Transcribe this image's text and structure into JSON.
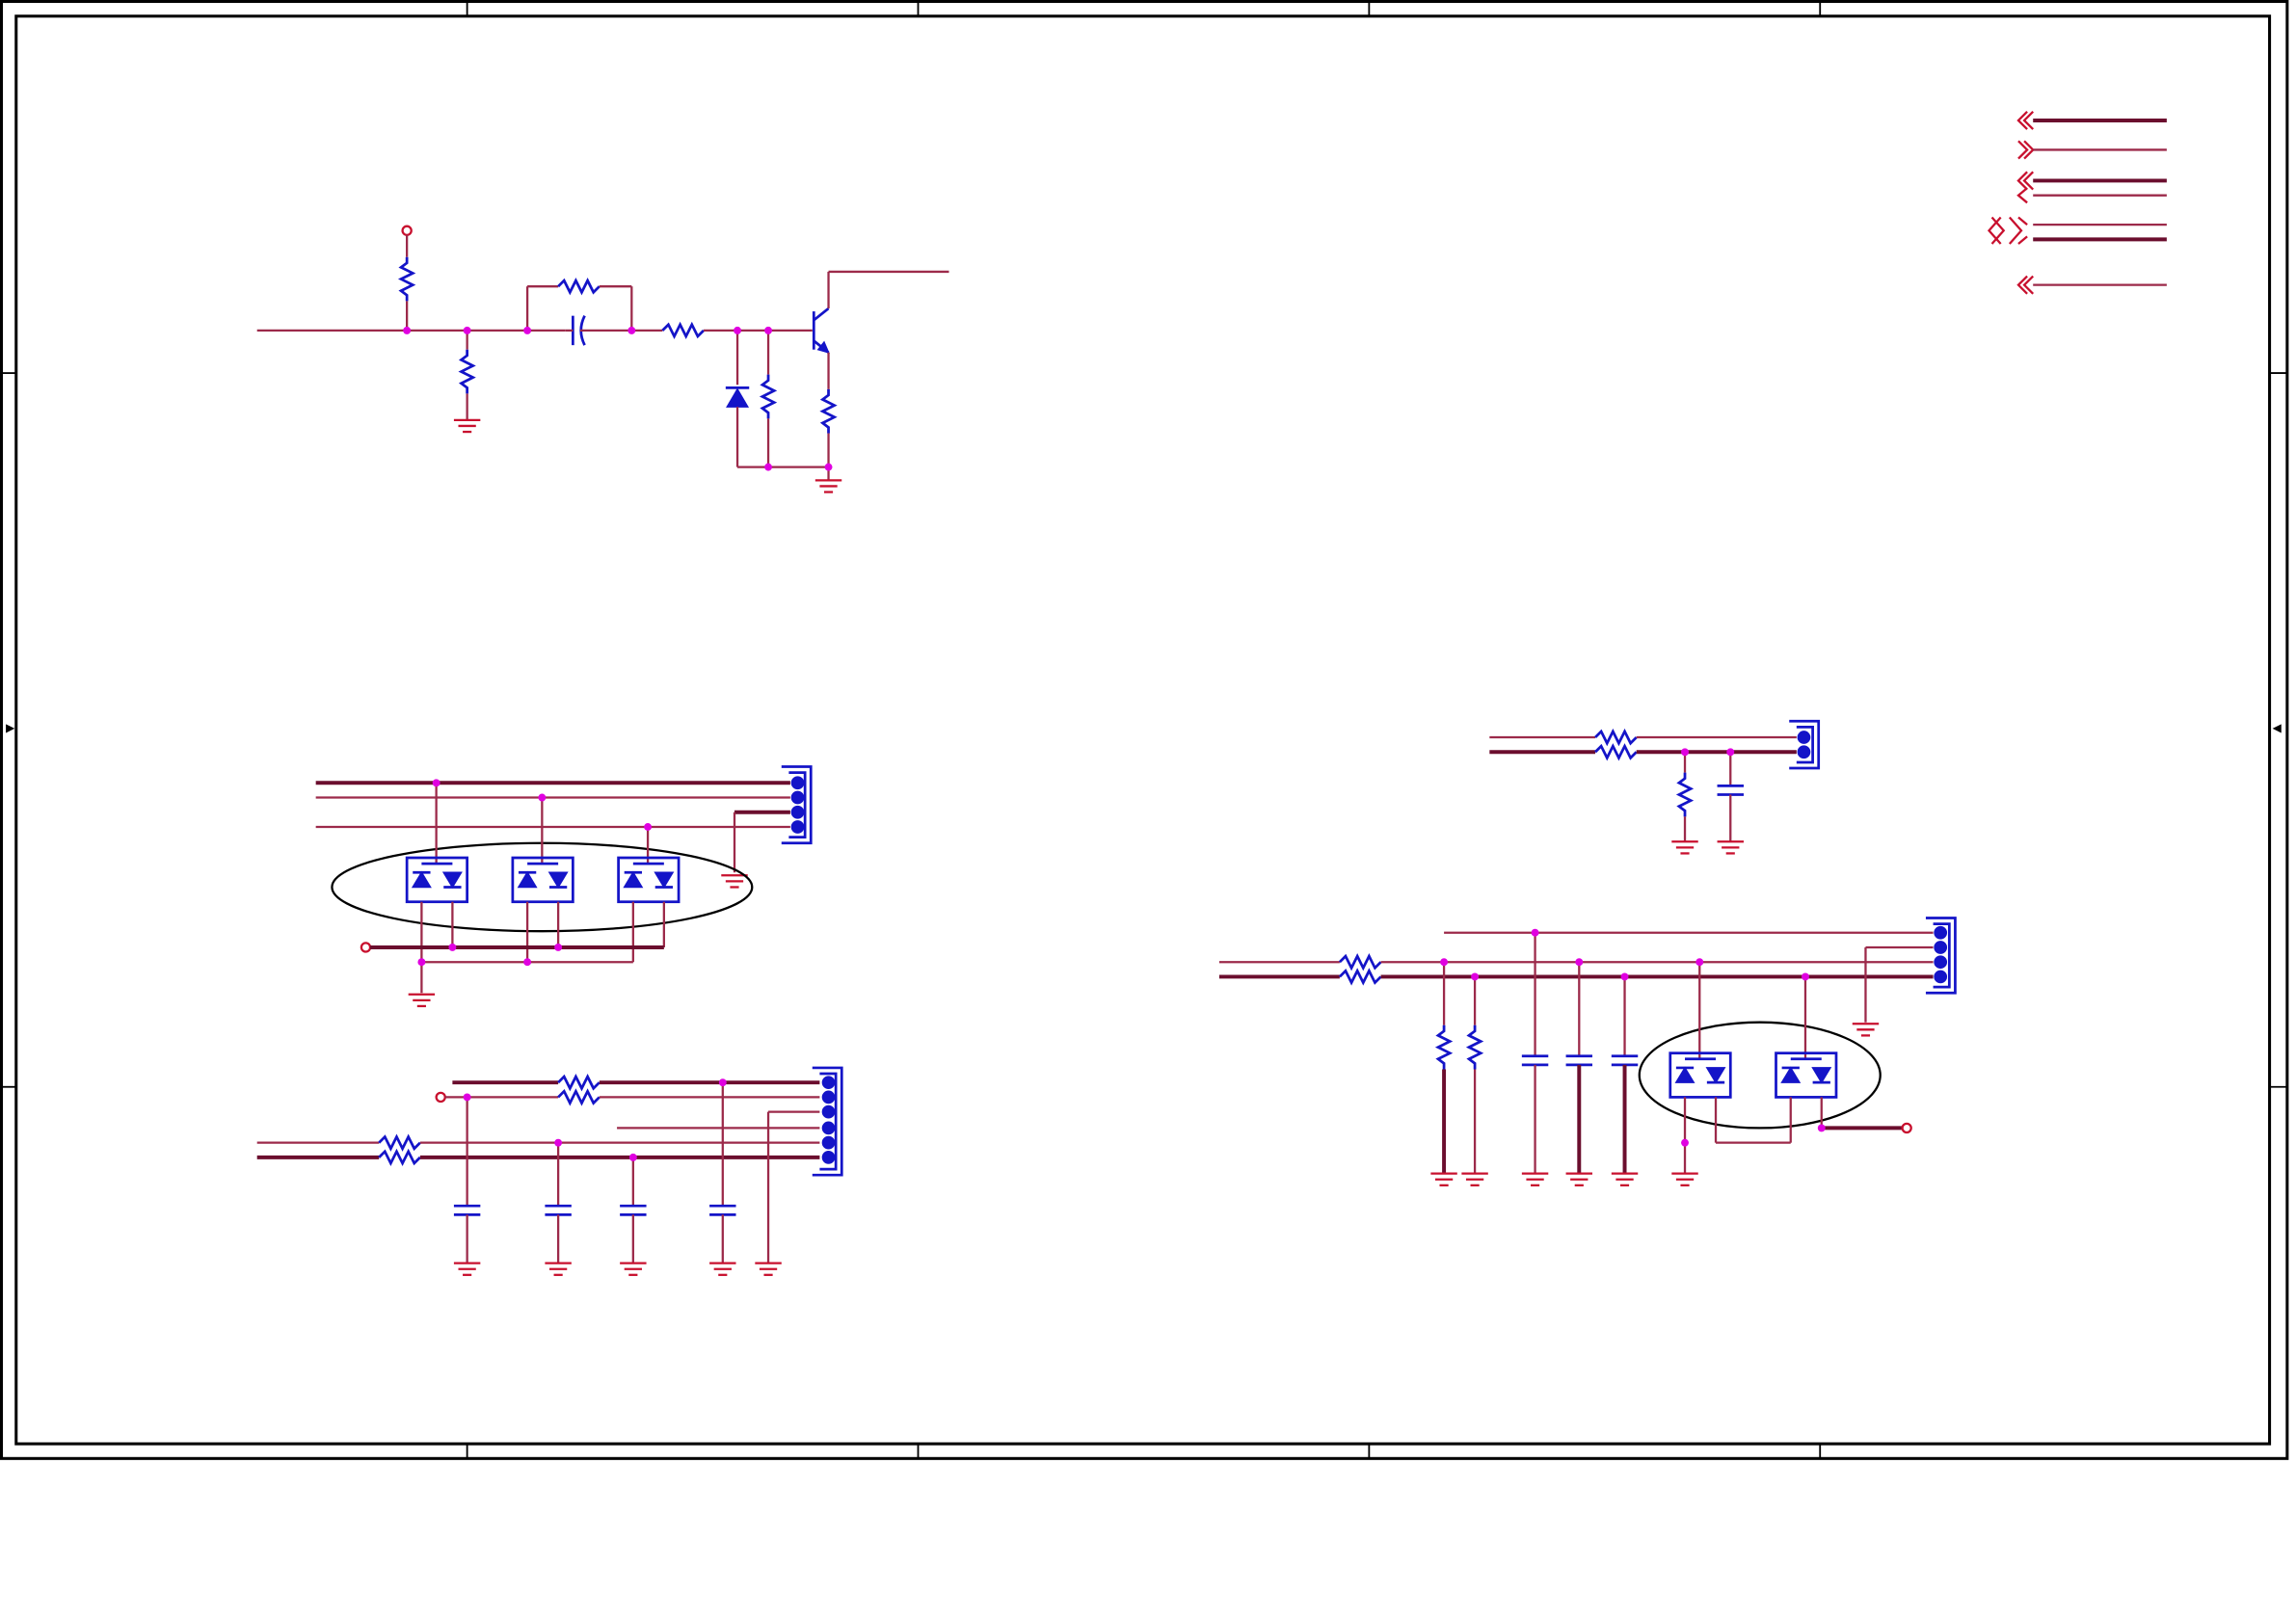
{
  "colors": {
    "wire": "#9c2a4a",
    "bus": "#6b0e2e",
    "part": "#1414c8",
    "pin": "#c8102e",
    "junction": "#e000e0"
  }
}
